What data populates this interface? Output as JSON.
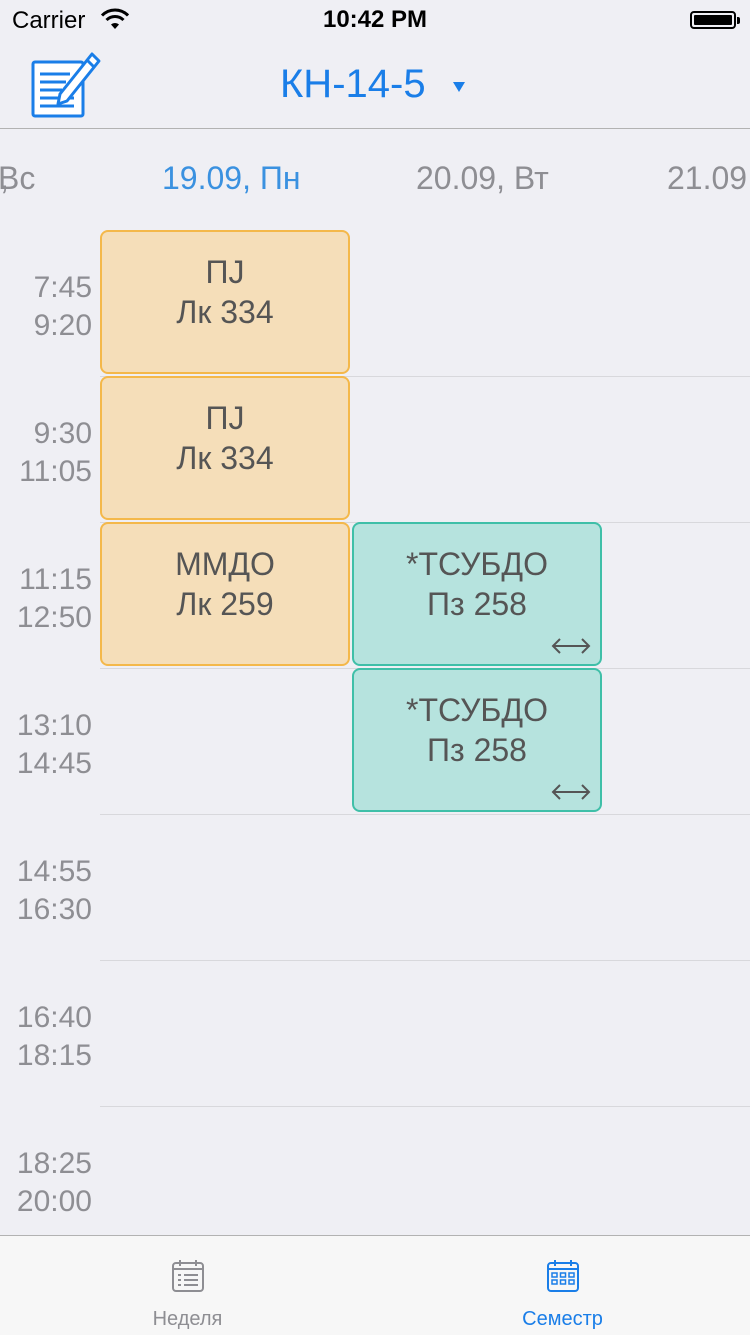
{
  "status": {
    "carrier": "Carrier",
    "time": "10:42 PM"
  },
  "nav": {
    "title": "КН-14-5",
    "edit_icon": "compose-icon"
  },
  "days": [
    "Вс",
    "19.09, Пн",
    "20.09, Вт",
    "21.09"
  ],
  "slots": [
    {
      "start": "7:45",
      "end": "9:20"
    },
    {
      "start": "9:30",
      "end": "11:05"
    },
    {
      "start": "11:15",
      "end": "12:50"
    },
    {
      "start": "13:10",
      "end": "14:45"
    },
    {
      "start": "14:55",
      "end": "16:30"
    },
    {
      "start": "16:40",
      "end": "18:15"
    },
    {
      "start": "18:25",
      "end": "20:00"
    }
  ],
  "events": [
    {
      "line1": "ПJ",
      "line2": "Лк 334",
      "color": "#f5deb9"
    },
    {
      "line1": "ПJ",
      "line2": "Лк 334",
      "color": "#f5deb9"
    },
    {
      "line1": "ММДО",
      "line2": "Лк 259",
      "color": "#f5deb9"
    },
    {
      "line1": "*ТСУБДО",
      "line2": "Пз 258",
      "color": "#b6e3de",
      "icon": "swap-arrow-icon"
    },
    {
      "line1": "*ТСУБДО",
      "line2": "Пз 258",
      "color": "#b6e3de",
      "icon": "swap-arrow-icon"
    }
  ],
  "tabs": [
    {
      "label": "Неделя",
      "icon": "list-calendar-icon",
      "active": false
    },
    {
      "label": "Семестр",
      "icon": "grid-calendar-icon",
      "active": true
    }
  ],
  "colors": {
    "accent": "#1a7ee8",
    "inactive": "#8e8e93"
  }
}
